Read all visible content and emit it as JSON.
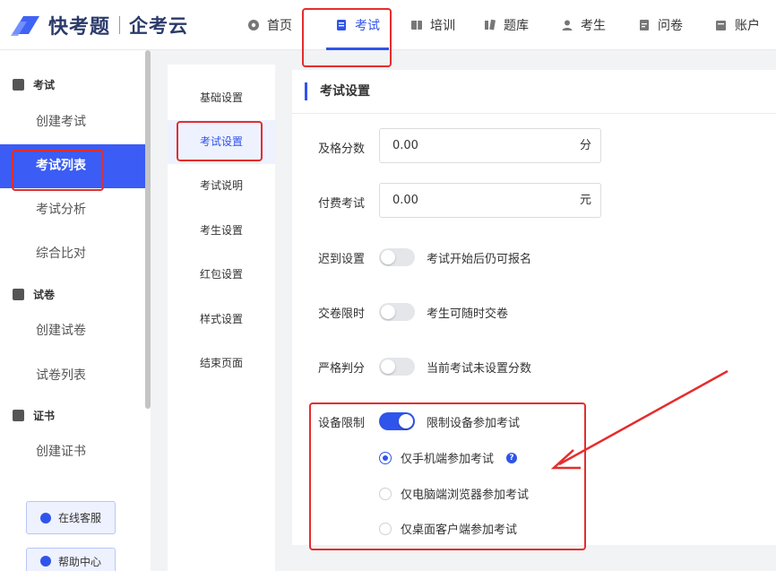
{
  "brand": {
    "name": "快考题",
    "sub": "企考云"
  },
  "nav": [
    {
      "label": "首页",
      "icon": "home-icon"
    },
    {
      "label": "考试",
      "icon": "exam-icon",
      "active": true
    },
    {
      "label": "培训",
      "icon": "training-icon"
    },
    {
      "label": "题库",
      "icon": "question-bank-icon"
    },
    {
      "label": "考生",
      "icon": "examinee-icon"
    },
    {
      "label": "问卷",
      "icon": "survey-icon"
    },
    {
      "label": "账户",
      "icon": "account-icon"
    }
  ],
  "sidebar": {
    "groups": [
      {
        "label": "考试",
        "items": [
          "创建考试",
          "考试列表",
          "考试分析",
          "综合比对"
        ],
        "active": "考试列表"
      },
      {
        "label": "试卷",
        "items": [
          "创建试卷",
          "试卷列表"
        ]
      },
      {
        "label": "证书",
        "items": [
          "创建证书"
        ]
      }
    ],
    "help_buttons": [
      "在线客服",
      "帮助中心"
    ]
  },
  "subnav": {
    "items": [
      "基础设置",
      "考试设置",
      "考试说明",
      "考生设置",
      "红包设置",
      "样式设置",
      "结束页面"
    ],
    "active": "考试设置"
  },
  "main": {
    "section_title": "考试设置",
    "pass_score": {
      "label": "及格分数",
      "value": "0.00",
      "unit": "分"
    },
    "paid_exam": {
      "label": "付费考试",
      "value": "0.00",
      "unit": "元"
    },
    "late": {
      "label": "迟到设置",
      "text": "考试开始后仍可报名",
      "on": false
    },
    "submit_limit": {
      "label": "交卷限时",
      "text": "考生可随时交卷",
      "on": false
    },
    "strict_scoring": {
      "label": "严格判分",
      "text": "当前考试未设置分数",
      "on": false
    },
    "device_limit": {
      "label": "设备限制",
      "text": "限制设备参加考试",
      "on": true,
      "options": [
        "仅手机端参加考试",
        "仅电脑端浏览器参加考试",
        "仅桌面客户端参加考试"
      ],
      "selected": "仅手机端参加考试",
      "help_mark": "?"
    }
  },
  "colors": {
    "accent": "#2f54eb",
    "annotation": "#e52d2d"
  }
}
